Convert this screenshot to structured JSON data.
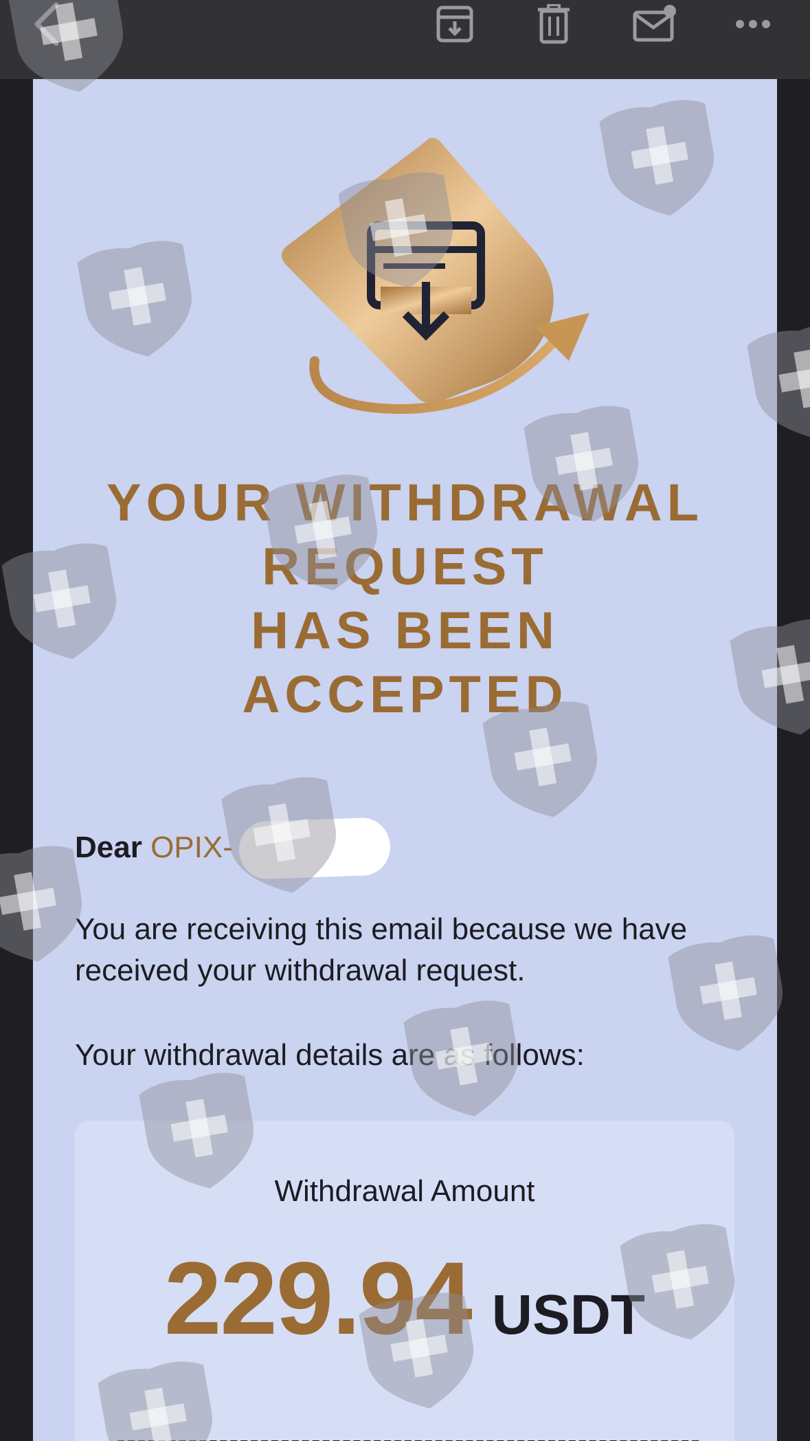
{
  "toolbar": {
    "icons": [
      "back-icon",
      "archive-icon",
      "trash-icon",
      "mark-unread-icon",
      "more-icon"
    ]
  },
  "email": {
    "headline": [
      "YOUR WITHDRAWAL",
      "REQUEST",
      "HAS BEEN",
      "ACCEPTED"
    ],
    "greeting_prefix": "Dear",
    "greeting_name": "OPIX-",
    "body_line1": "You are receiving this email because we have received your withdrawal request.",
    "body_line2": "Your withdrawal details are as follows:",
    "detail": {
      "label": "Withdrawal Amount",
      "amount": "229.94",
      "unit": "USDT"
    }
  },
  "colors": {
    "accent_gold": "#9a6b33",
    "email_background": "#cad3f0",
    "toolbar_background": "#323235",
    "card_background": "#d6def6"
  }
}
